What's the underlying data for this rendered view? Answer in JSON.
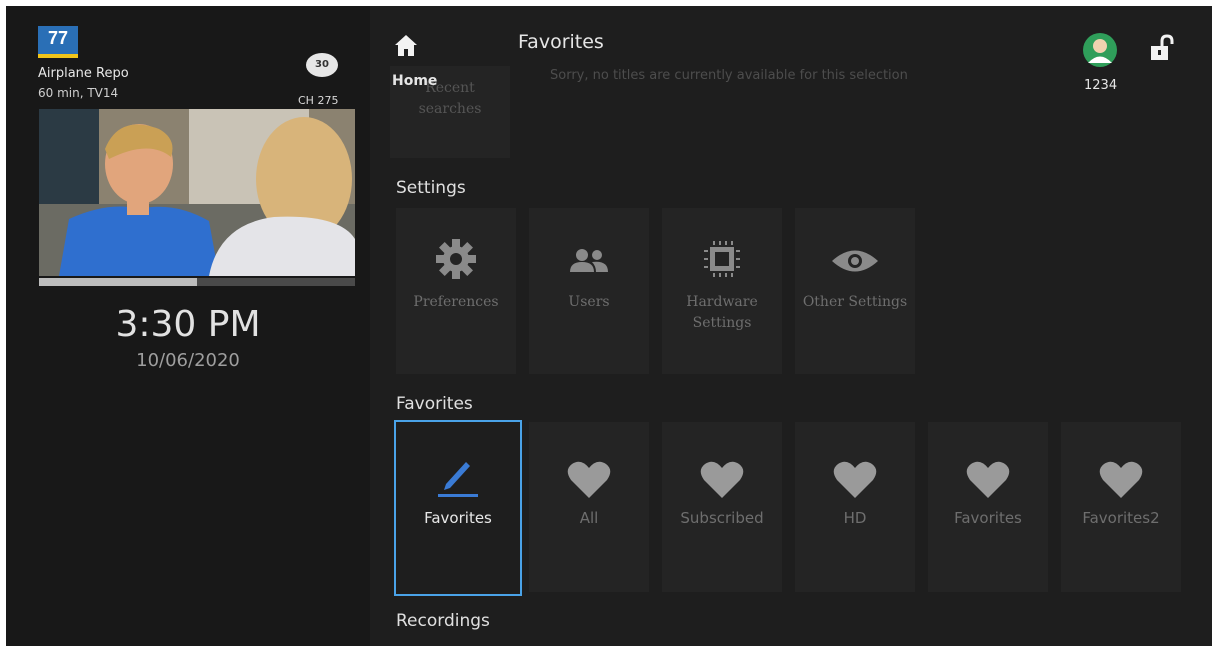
{
  "program": {
    "channel_logo": "77",
    "title": "Airplane Repo",
    "meta": "60 min, TV14",
    "network_logo": "30",
    "channel_number": "CH 275",
    "progress_fraction": 0.5,
    "clock": "3:30 PM",
    "date": "10/06/2020"
  },
  "header": {
    "title": "Favorites",
    "home_label": "Home",
    "ghost_message": "Sorry, no titles are currently available for this selection",
    "user_code": "1234"
  },
  "sections": {
    "recent_searches": "Recent searches",
    "settings": {
      "label": "Settings",
      "items": [
        {
          "label": "Preferences",
          "icon": "gear-icon"
        },
        {
          "label": "Users",
          "icon": "users-icon"
        },
        {
          "label": "Hardware Settings",
          "icon": "chip-icon"
        },
        {
          "label": "Other Settings",
          "icon": "eye-icon"
        }
      ]
    },
    "favorites": {
      "label": "Favorites",
      "items": [
        {
          "label": "Favorites",
          "icon": "pencil-icon",
          "selected": true
        },
        {
          "label": "All",
          "icon": "heart-icon"
        },
        {
          "label": "Subscribed",
          "icon": "heart-icon"
        },
        {
          "label": "HD",
          "icon": "heart-icon"
        },
        {
          "label": "Favorites",
          "icon": "heart-icon"
        },
        {
          "label": "Favorites2",
          "icon": "heart-icon"
        }
      ]
    },
    "recordings": {
      "label": "Recordings"
    }
  },
  "colors": {
    "selection_border": "#4aa3e8",
    "edit_icon": "#3a7bd5",
    "avatar_bg": "#2f9e5a"
  }
}
